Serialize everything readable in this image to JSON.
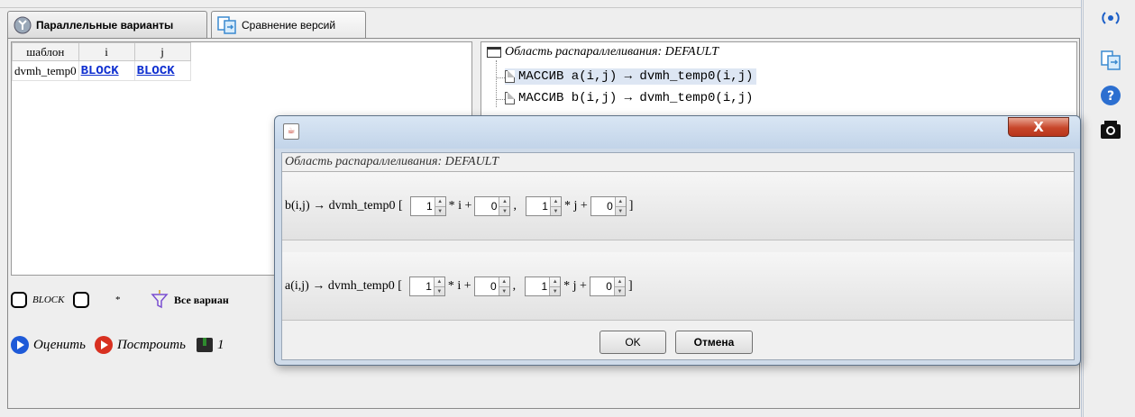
{
  "tabs": [
    {
      "label": "Параллельные варианты",
      "icon": "parallel-icon"
    },
    {
      "label": "Сравнение версий",
      "icon": "compare-icon"
    }
  ],
  "table": {
    "headers": [
      "шаблон",
      "i",
      "j"
    ],
    "rows": [
      [
        "dvmh_temp0",
        "BLOCK",
        "BLOCK"
      ]
    ]
  },
  "tree": {
    "root": "Область распараллеливания: DEFAULT",
    "items": [
      "МАССИВ a(i,j) → dvmh_temp0(i,j)",
      "МАССИВ b(i,j) → dvmh_temp0(i,j)"
    ]
  },
  "filters": {
    "block_label": "BLOCK",
    "star_label": "*",
    "all_variants_label": "Все вариан"
  },
  "actions": {
    "evaluate_label": "Оценить",
    "build_label": "Построить",
    "third_label": "1"
  },
  "rightbar_icons": [
    "radio-icon",
    "compare-icon",
    "help-icon",
    "camera-icon"
  ],
  "dialog": {
    "close_label": "X",
    "header": "Область распараллеливания: DEFAULT",
    "rows": [
      {
        "label": "b(i,j) → dvmh_temp0 [",
        "v1": "1",
        "v2": "0",
        "v3": "1",
        "v4": "0"
      },
      {
        "label": "a(i,j) → dvmh_temp0 [",
        "v1": "1",
        "v2": "0",
        "v3": "1",
        "v4": "0"
      }
    ],
    "ops": {
      "mul_i": "* i +",
      "comma": ",",
      "mul_j": "* j +",
      "close": "]"
    },
    "ok_label": "OK",
    "cancel_label": "Отмена"
  },
  "colors": {
    "accent_blue": "#1e5ad8",
    "accent_red": "#d83020",
    "link_blue": "#1030d0"
  }
}
